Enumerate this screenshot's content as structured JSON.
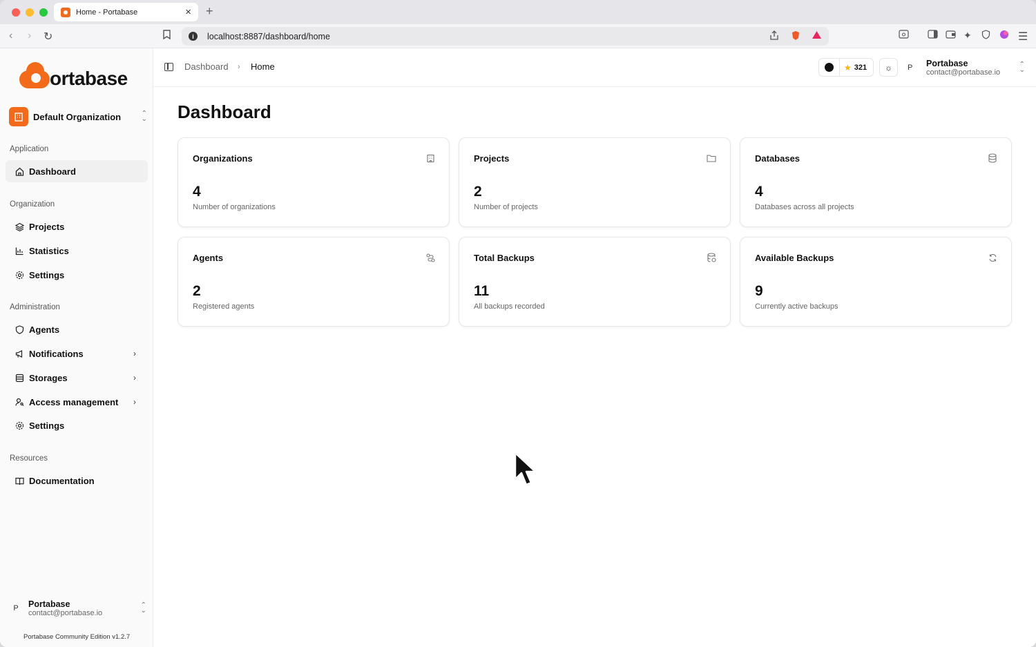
{
  "browser": {
    "tab_title": "Home - Portabase",
    "url": "localhost:8887/dashboard/home",
    "traffic_colors": [
      "#ff5f57",
      "#febc2e",
      "#28c840"
    ]
  },
  "sidebar": {
    "brand": "ortabase",
    "organization": "Default Organization",
    "sections": [
      {
        "label": "Application",
        "items": [
          {
            "label": "Dashboard",
            "icon": "home-icon"
          }
        ]
      },
      {
        "label": "Organization",
        "items": [
          {
            "label": "Projects",
            "icon": "layers-icon"
          },
          {
            "label": "Statistics",
            "icon": "chart-icon"
          },
          {
            "label": "Settings",
            "icon": "gear-icon"
          }
        ]
      },
      {
        "label": "Administration",
        "items": [
          {
            "label": "Agents",
            "icon": "shield-icon"
          },
          {
            "label": "Notifications",
            "icon": "megaphone-icon"
          },
          {
            "label": "Storages",
            "icon": "database-icon"
          },
          {
            "label": "Access management",
            "icon": "user-key-icon"
          },
          {
            "label": "Settings",
            "icon": "gear-icon"
          }
        ]
      },
      {
        "label": "Resources",
        "items": [
          {
            "label": "Documentation",
            "icon": "book-icon"
          }
        ]
      }
    ],
    "user": {
      "avatar": "P",
      "name": "Portabase",
      "email": "contact@portabase.io"
    },
    "edition": "Portabase Community Edition v1.2.7"
  },
  "header": {
    "breadcrumb": [
      "Dashboard",
      "Home"
    ],
    "github_stars": "321",
    "user": {
      "avatar": "P",
      "name": "Portabase",
      "email": "contact@portabase.io"
    }
  },
  "main": {
    "title": "Dashboard",
    "cards": [
      {
        "title": "Organizations",
        "value": "4",
        "desc": "Number of organizations",
        "icon": "building-icon"
      },
      {
        "title": "Projects",
        "value": "2",
        "desc": "Number of projects",
        "icon": "folder-icon"
      },
      {
        "title": "Databases",
        "value": "4",
        "desc": "Databases across all projects",
        "icon": "database-icon"
      },
      {
        "title": "Agents",
        "value": "2",
        "desc": "Registered agents",
        "icon": "route-icon"
      },
      {
        "title": "Total Backups",
        "value": "11",
        "desc": "All backups recorded",
        "icon": "database-backup-icon"
      },
      {
        "title": "Available Backups",
        "value": "9",
        "desc": "Currently active backups",
        "icon": "refresh-icon"
      }
    ]
  },
  "colors": {
    "brand": "#f26a1a",
    "star": "#f5b400"
  }
}
